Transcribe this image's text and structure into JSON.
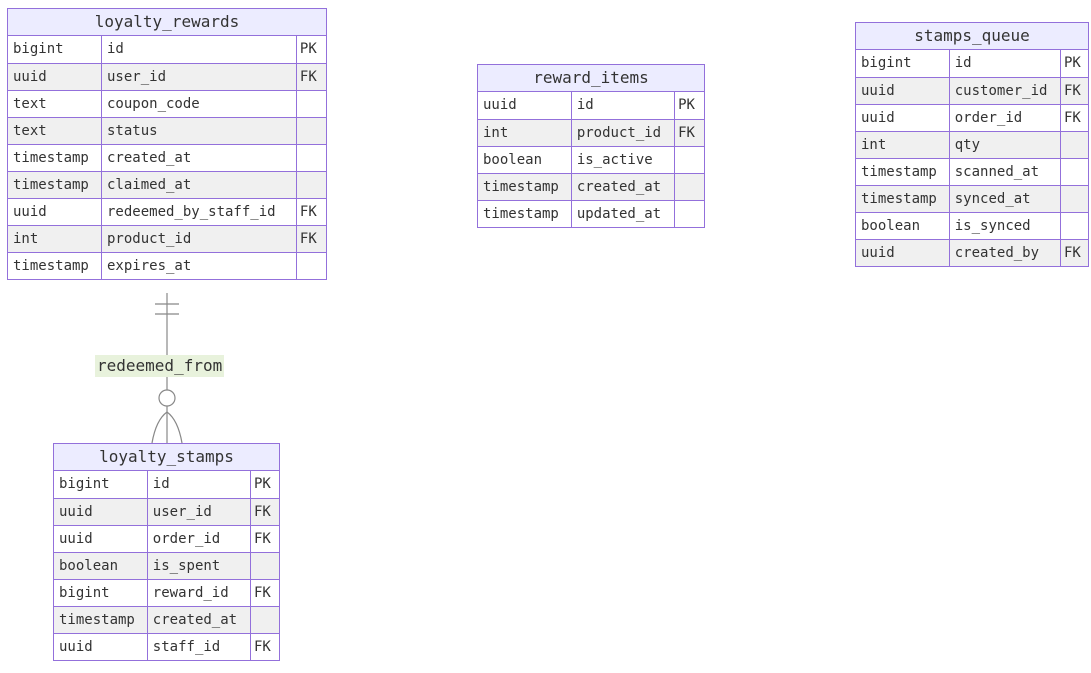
{
  "colors": {
    "border": "#9370db",
    "header_fill": "#ececff",
    "alt_row": "#f0f0f0",
    "line": "#888888",
    "label_bg": "#e8f2dc"
  },
  "entities": {
    "loyalty_rewards": {
      "name": "loyalty_rewards",
      "rows": [
        {
          "type": "bigint",
          "name": "id",
          "key": "PK"
        },
        {
          "type": "uuid",
          "name": "user_id",
          "key": "FK"
        },
        {
          "type": "text",
          "name": "coupon_code",
          "key": ""
        },
        {
          "type": "text",
          "name": "status",
          "key": ""
        },
        {
          "type": "timestamp",
          "name": "created_at",
          "key": ""
        },
        {
          "type": "timestamp",
          "name": "claimed_at",
          "key": ""
        },
        {
          "type": "uuid",
          "name": "redeemed_by_staff_id",
          "key": "FK"
        },
        {
          "type": "int",
          "name": "product_id",
          "key": "FK"
        },
        {
          "type": "timestamp",
          "name": "expires_at",
          "key": ""
        }
      ]
    },
    "reward_items": {
      "name": "reward_items",
      "rows": [
        {
          "type": "uuid",
          "name": "id",
          "key": "PK"
        },
        {
          "type": "int",
          "name": "product_id",
          "key": "FK"
        },
        {
          "type": "boolean",
          "name": "is_active",
          "key": ""
        },
        {
          "type": "timestamp",
          "name": "created_at",
          "key": ""
        },
        {
          "type": "timestamp",
          "name": "updated_at",
          "key": ""
        }
      ]
    },
    "stamps_queue": {
      "name": "stamps_queue",
      "rows": [
        {
          "type": "bigint",
          "name": "id",
          "key": "PK"
        },
        {
          "type": "uuid",
          "name": "customer_id",
          "key": "FK"
        },
        {
          "type": "uuid",
          "name": "order_id",
          "key": "FK"
        },
        {
          "type": "int",
          "name": "qty",
          "key": ""
        },
        {
          "type": "timestamp",
          "name": "scanned_at",
          "key": ""
        },
        {
          "type": "timestamp",
          "name": "synced_at",
          "key": ""
        },
        {
          "type": "boolean",
          "name": "is_synced",
          "key": ""
        },
        {
          "type": "uuid",
          "name": "created_by",
          "key": "FK"
        }
      ]
    },
    "loyalty_stamps": {
      "name": "loyalty_stamps",
      "rows": [
        {
          "type": "bigint",
          "name": "id",
          "key": "PK"
        },
        {
          "type": "uuid",
          "name": "user_id",
          "key": "FK"
        },
        {
          "type": "uuid",
          "name": "order_id",
          "key": "FK"
        },
        {
          "type": "boolean",
          "name": "is_spent",
          "key": ""
        },
        {
          "type": "bigint",
          "name": "reward_id",
          "key": "FK"
        },
        {
          "type": "timestamp",
          "name": "created_at",
          "key": ""
        },
        {
          "type": "uuid",
          "name": "staff_id",
          "key": "FK"
        }
      ]
    }
  },
  "relationship": {
    "label": "redeemed_from",
    "from": "loyalty_rewards",
    "to": "loyalty_stamps",
    "from_cardinality": "exactly-one",
    "to_cardinality": "zero-or-many"
  }
}
